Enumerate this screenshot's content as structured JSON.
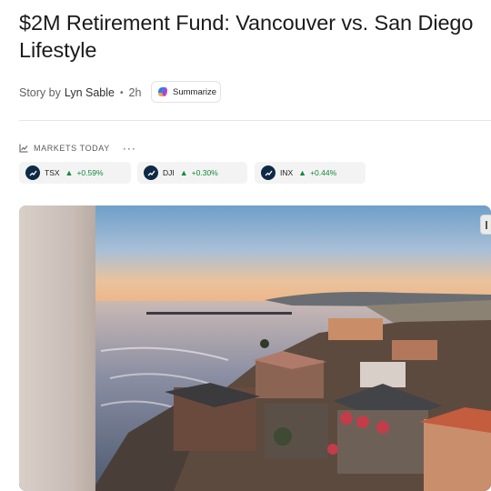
{
  "article": {
    "title": "$2M Retirement Fund: Vancouver vs. San Diego Lifestyle",
    "story_by_prefix": "Story by",
    "author": "Lyn Sable",
    "separator": "•",
    "age": "2h",
    "summarize_label": "Summarize"
  },
  "markets": {
    "heading": "MARKETS TODAY",
    "more": "···",
    "tickers": [
      {
        "symbol": "TSX",
        "arrow": "▲",
        "change": "+0.59%"
      },
      {
        "symbol": "DJI",
        "arrow": "▲",
        "change": "+0.30%"
      },
      {
        "symbol": "INX",
        "arrow": "▲",
        "change": "+0.44%"
      }
    ]
  },
  "colors": {
    "positive": "#128a3a",
    "ticker_badge": "#0e2a46",
    "ticker_bg": "#f3f3f3"
  },
  "icons": {
    "summarize": "copilot-icon",
    "markets": "line-chart-icon",
    "ticker": "chart-badge-icon"
  }
}
